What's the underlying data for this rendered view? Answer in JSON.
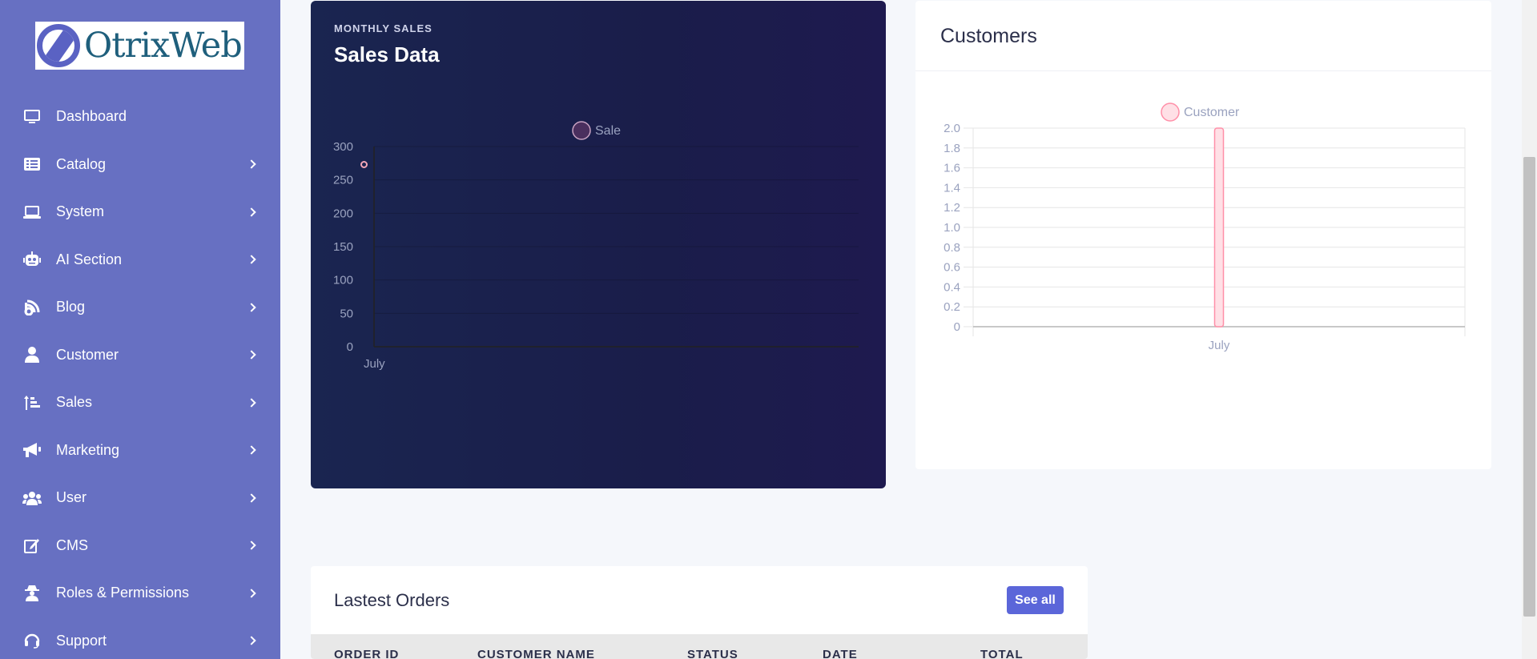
{
  "brand": {
    "logo_text": "OtrixWeb"
  },
  "sidebar": {
    "items": [
      {
        "label": "Dashboard",
        "icon": "monitor-icon",
        "has_children": false
      },
      {
        "label": "Catalog",
        "icon": "list-icon",
        "has_children": true
      },
      {
        "label": "System",
        "icon": "laptop-icon",
        "has_children": true
      },
      {
        "label": "AI Section",
        "icon": "robot-icon",
        "has_children": true
      },
      {
        "label": "Blog",
        "icon": "blog-icon",
        "has_children": true
      },
      {
        "label": "Customer",
        "icon": "user-icon",
        "has_children": true
      },
      {
        "label": "Sales",
        "icon": "sort-list-icon",
        "has_children": true
      },
      {
        "label": "Marketing",
        "icon": "megaphone-icon",
        "has_children": true
      },
      {
        "label": "User",
        "icon": "users-icon",
        "has_children": true
      },
      {
        "label": "CMS",
        "icon": "edit-icon",
        "has_children": true
      },
      {
        "label": "Roles & Permissions",
        "icon": "user-secret-icon",
        "has_children": true
      },
      {
        "label": "Support",
        "icon": "headset-icon",
        "has_children": true
      }
    ]
  },
  "sales_card": {
    "eyebrow": "MONTHLY SALES",
    "title": "Sales Data"
  },
  "customers_card": {
    "title": "Customers"
  },
  "orders_card": {
    "title": "Lastest Orders",
    "see_all_label": "See all",
    "columns": [
      "ORDER ID",
      "CUSTOMER NAME",
      "STATUS",
      "DATE",
      "TOTAL"
    ]
  },
  "chart_data": [
    {
      "type": "line",
      "categories": [
        "July"
      ],
      "series": [
        {
          "name": "Sale",
          "values": [
            273
          ]
        }
      ],
      "ylim": [
        0,
        300
      ],
      "yticks": [
        0,
        50,
        100,
        150,
        200,
        250,
        300
      ],
      "legend": "top",
      "grid": true,
      "colors": {
        "point": "#f2a7b7",
        "legend_fill": "#4a2f5e",
        "legend_stroke": "#c9a3c3",
        "axis": "#222"
      }
    },
    {
      "type": "bar",
      "categories": [
        "July"
      ],
      "series": [
        {
          "name": "Customer",
          "values": [
            2
          ]
        }
      ],
      "ylim": [
        0,
        2
      ],
      "yticks": [
        "0",
        "0.2",
        "0.4",
        "0.6",
        "0.8",
        "1.0",
        "1.2",
        "1.4",
        "1.6",
        "1.8",
        "2.0"
      ],
      "legend": "top",
      "grid": true,
      "colors": {
        "bar_fill": "#ffe0e6",
        "bar_stroke": "#ff8fa8",
        "grid": "#e6e6e6"
      }
    }
  ]
}
